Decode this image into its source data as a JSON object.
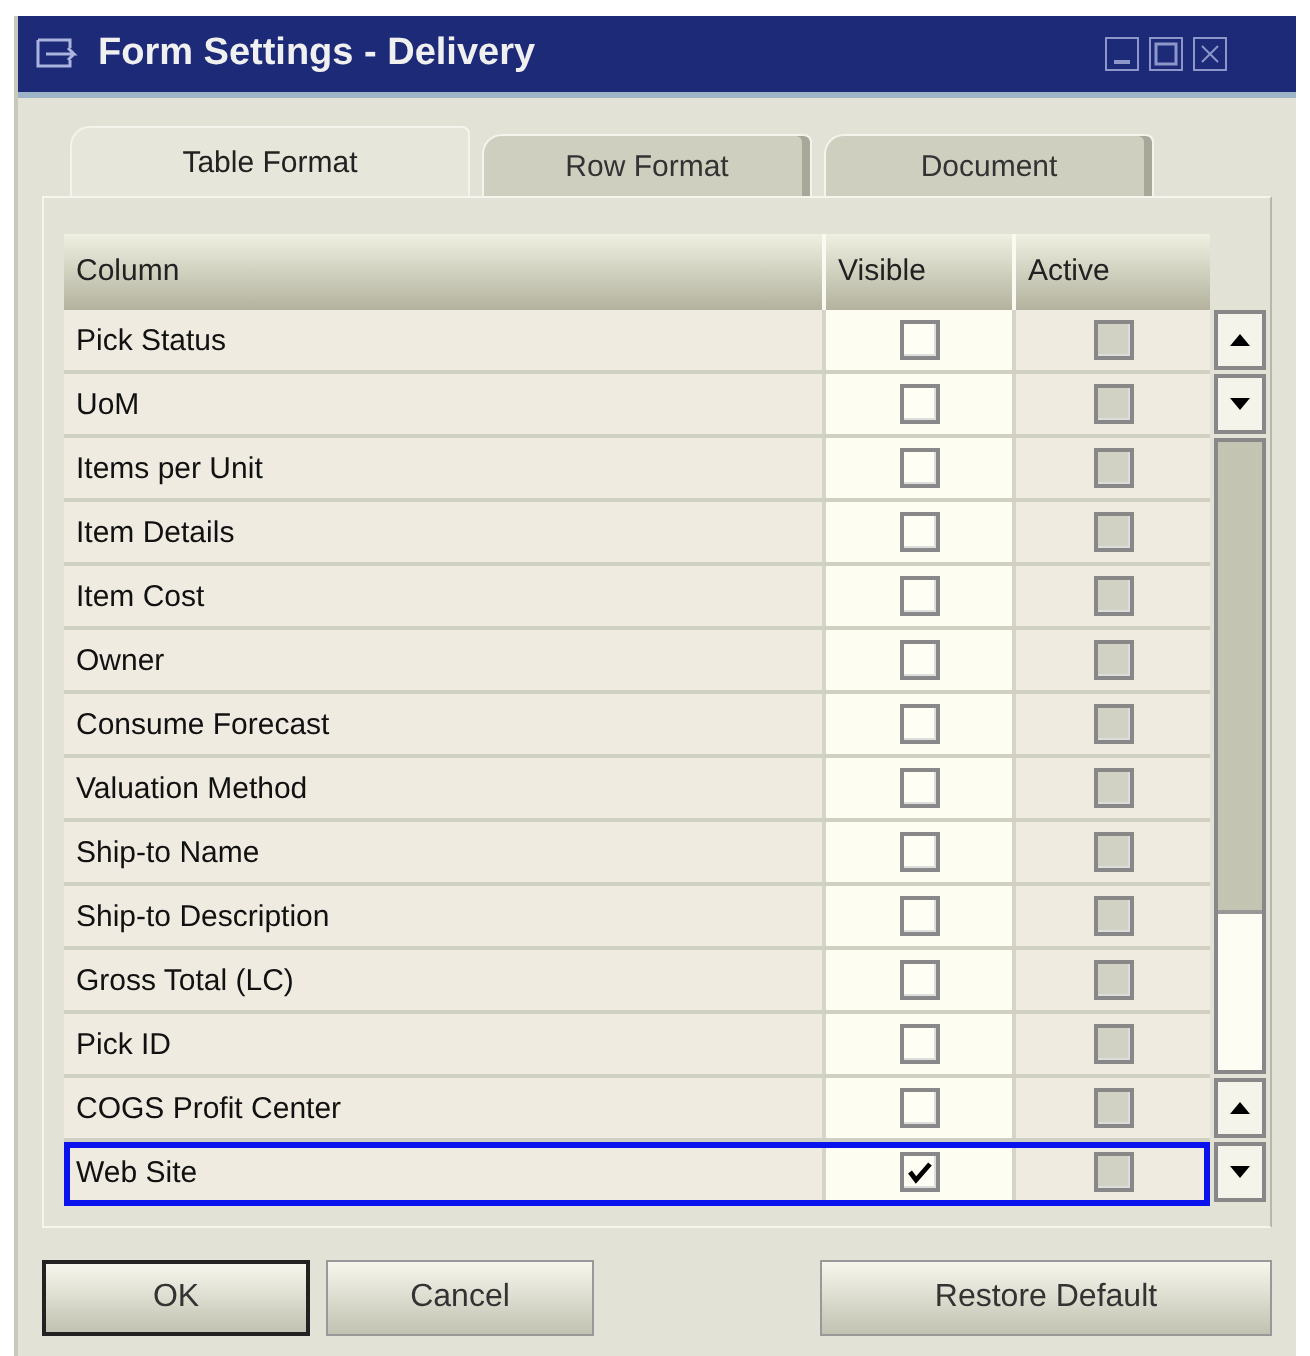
{
  "window": {
    "title": "Form Settings - Delivery"
  },
  "tabs": [
    {
      "label": "Table Format",
      "selected": true
    },
    {
      "label": "Row Format",
      "selected": false
    },
    {
      "label": "Document",
      "selected": false
    }
  ],
  "table": {
    "columns": [
      {
        "label": "Column"
      },
      {
        "label": "Visible"
      },
      {
        "label": "Active",
        "disabled": true
      }
    ],
    "rows": [
      {
        "name": "Pick Status",
        "visible": false,
        "active": false,
        "selected": false
      },
      {
        "name": "UoM",
        "visible": false,
        "active": false,
        "selected": false
      },
      {
        "name": "Items per Unit",
        "visible": false,
        "active": false,
        "selected": false
      },
      {
        "name": "Item Details",
        "visible": false,
        "active": false,
        "selected": false
      },
      {
        "name": "Item Cost",
        "visible": false,
        "active": false,
        "selected": false
      },
      {
        "name": "Owner",
        "visible": false,
        "active": false,
        "selected": false
      },
      {
        "name": "Consume Forecast",
        "visible": false,
        "active": false,
        "selected": false
      },
      {
        "name": "Valuation Method",
        "visible": false,
        "active": false,
        "selected": false
      },
      {
        "name": "Ship-to Name",
        "visible": false,
        "active": false,
        "selected": false
      },
      {
        "name": "Ship-to Description",
        "visible": false,
        "active": false,
        "selected": false
      },
      {
        "name": "Gross Total (LC)",
        "visible": false,
        "active": false,
        "selected": false
      },
      {
        "name": "Pick ID",
        "visible": false,
        "active": false,
        "selected": false
      },
      {
        "name": "COGS Profit Center",
        "visible": false,
        "active": false,
        "selected": false
      },
      {
        "name": "Web Site",
        "visible": true,
        "active": false,
        "selected": true
      }
    ]
  },
  "buttons": [
    {
      "label": "OK",
      "kind": "default"
    },
    {
      "label": "Cancel",
      "kind": "normal"
    },
    {
      "label": "Restore Default",
      "kind": "normal"
    }
  ]
}
